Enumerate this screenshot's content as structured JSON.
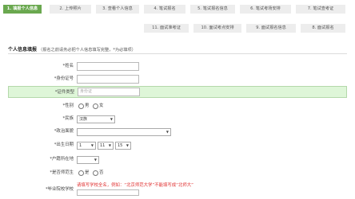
{
  "steps": [
    {
      "label": "1. 填报个人信息",
      "active": true
    },
    {
      "label": "2. 上传照片",
      "active": false
    },
    {
      "label": "3. 查看个人信息",
      "active": false
    },
    {
      "label": "4. 笔试报名",
      "active": false
    },
    {
      "label": "5. 笔试报名信息",
      "active": false
    },
    {
      "label": "6. 笔试考场安排",
      "active": false
    },
    {
      "label": "7. 笔试查考证",
      "active": false
    },
    {
      "label": "11. 面试准考证",
      "active": false
    },
    {
      "label": "10. 面试考点安排",
      "active": false
    },
    {
      "label": "9. 面试报名信息",
      "active": false
    },
    {
      "label": "8. 面试报名",
      "active": false
    }
  ],
  "section": {
    "title": "个人信息填报",
    "hint": "（报名之前请务必把个人信息填写完整，*为必填项）"
  },
  "form": {
    "name_label": "*姓名",
    "id_number_label": "*身份证号",
    "id_type_label": "*证件类型",
    "id_type_value": "身份证",
    "gender_label": "*性别",
    "gender_male": "男",
    "gender_female": "女",
    "ethnicity_label": "*民族",
    "ethnicity_value": "汉族",
    "political_label": "*政治面貌",
    "political_value": "",
    "birthdate_label": "*出生日期",
    "birth_year": "1",
    "birth_month": "11",
    "birth_day": "15",
    "hukou_label": "*户籍所在地",
    "normal_student_label": "*是否师范生",
    "normal_yes": "是",
    "normal_no": "否",
    "school_label": "*毕业院校学校",
    "school_note": "请填写学校全名，例如：“北京师范大学”不能填写成“北师大”"
  }
}
